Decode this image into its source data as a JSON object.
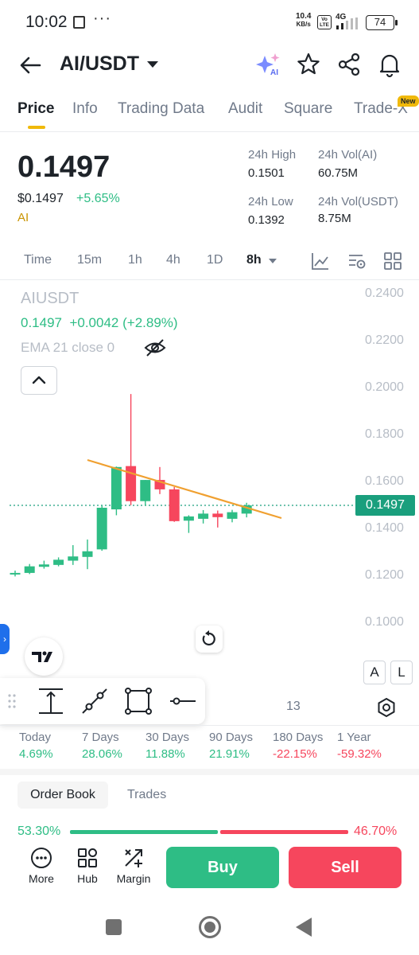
{
  "status_bar": {
    "time": "10:02",
    "network_speed_value": "10.4",
    "network_speed_unit": "KB/s",
    "volte": "Vo LTE",
    "network_type": "4G",
    "battery": "74",
    "icons": [
      "screenshot-icon",
      "more-dots-icon",
      "signal-icon",
      "battery-icon"
    ]
  },
  "header": {
    "pair": "AI/USDT",
    "icons": [
      "back-arrow-icon",
      "dropdown-caret-icon",
      "ai-sparkle-icon",
      "star-icon",
      "share-icon",
      "bell-icon"
    ]
  },
  "tabs": [
    {
      "label": "Price",
      "active": true
    },
    {
      "label": "Info"
    },
    {
      "label": "Trading Data"
    },
    {
      "label": "Audit"
    },
    {
      "label": "Square"
    },
    {
      "label": "Trade-X",
      "badge": "New"
    }
  ],
  "price": {
    "last": "0.1497",
    "usd": "$0.1497",
    "change": "+5.65%",
    "tag": "AI",
    "high_label": "24h High",
    "high": "0.1501",
    "low_label": "24h Low",
    "low": "0.1392",
    "vol_base_label": "24h Vol(AI)",
    "vol_base": "60.75M",
    "vol_quote_label": "24h Vol(USDT)",
    "vol_quote": "8.75M"
  },
  "intervals": {
    "items": [
      "Time",
      "15m",
      "1h",
      "4h",
      "1D",
      "8h"
    ],
    "selected": "8h",
    "tool_icons": [
      "indicator-icon",
      "settings-icon",
      "layout-grid-icon"
    ]
  },
  "chart": {
    "symbol": "AIUSDT",
    "legend_price": "0.1497",
    "legend_change": "+0.0042 (+2.89%)",
    "ema_label": "EMA 21 close 0",
    "current_price_tag": "0.1497",
    "x_label": "13",
    "auto_btn": "A",
    "log_btn": "L",
    "colors": {
      "up": "#2ebd85",
      "down": "#f6465d",
      "trendline": "#f0a030",
      "price_line": "#1a9f7d"
    }
  },
  "chart_data": {
    "type": "candlestick",
    "ylim": [
      0.09,
      0.245
    ],
    "y_ticks": [
      "0.2400",
      "0.2200",
      "0.2000",
      "0.1800",
      "0.1600",
      "0.1400",
      "0.1200",
      "0.1000"
    ],
    "candles": [
      {
        "o": 0.1207,
        "h": 0.122,
        "l": 0.1195,
        "c": 0.121
      },
      {
        "o": 0.121,
        "h": 0.1248,
        "l": 0.1205,
        "c": 0.1238
      },
      {
        "o": 0.1236,
        "h": 0.1262,
        "l": 0.1228,
        "c": 0.1246
      },
      {
        "o": 0.1244,
        "h": 0.1276,
        "l": 0.1238,
        "c": 0.1266
      },
      {
        "o": 0.1262,
        "h": 0.1328,
        "l": 0.1244,
        "c": 0.128
      },
      {
        "o": 0.1278,
        "h": 0.1352,
        "l": 0.1226,
        "c": 0.1302
      },
      {
        "o": 0.131,
        "h": 0.1495,
        "l": 0.1304,
        "c": 0.1487
      },
      {
        "o": 0.148,
        "h": 0.1662,
        "l": 0.1455,
        "c": 0.166
      },
      {
        "o": 0.1664,
        "h": 0.197,
        "l": 0.1498,
        "c": 0.1515
      },
      {
        "o": 0.1515,
        "h": 0.1605,
        "l": 0.1495,
        "c": 0.1605
      },
      {
        "o": 0.1605,
        "h": 0.166,
        "l": 0.1545,
        "c": 0.1565
      },
      {
        "o": 0.1565,
        "h": 0.1575,
        "l": 0.1427,
        "c": 0.143
      },
      {
        "o": 0.1432,
        "h": 0.1455,
        "l": 0.138,
        "c": 0.145
      },
      {
        "o": 0.144,
        "h": 0.1477,
        "l": 0.142,
        "c": 0.1462
      },
      {
        "o": 0.1462,
        "h": 0.1475,
        "l": 0.1403,
        "c": 0.1447
      },
      {
        "o": 0.144,
        "h": 0.1478,
        "l": 0.1425,
        "c": 0.1468
      },
      {
        "o": 0.1462,
        "h": 0.1508,
        "l": 0.1446,
        "c": 0.1497
      }
    ],
    "current_price": 0.1497
  },
  "drawing_tools": [
    "measure-icon",
    "trendline-tool-icon",
    "rectangle-tool-icon",
    "horizontal-line-icon"
  ],
  "performance": [
    {
      "label": "Today",
      "value": "4.69%",
      "dir": "up"
    },
    {
      "label": "7 Days",
      "value": "28.06%",
      "dir": "up"
    },
    {
      "label": "30 Days",
      "value": "11.88%",
      "dir": "up"
    },
    {
      "label": "90 Days",
      "value": "21.91%",
      "dir": "up"
    },
    {
      "label": "180 Days",
      "value": "-22.15%",
      "dir": "down"
    },
    {
      "label": "1 Year",
      "value": "-59.32%",
      "dir": "down"
    }
  ],
  "orderbook": {
    "tab_active": "Order Book",
    "tab_other": "Trades",
    "bid_ratio": "53.30%",
    "ask_ratio": "46.70%"
  },
  "actions": {
    "more": "More",
    "hub": "Hub",
    "margin": "Margin",
    "buy": "Buy",
    "sell": "Sell"
  }
}
